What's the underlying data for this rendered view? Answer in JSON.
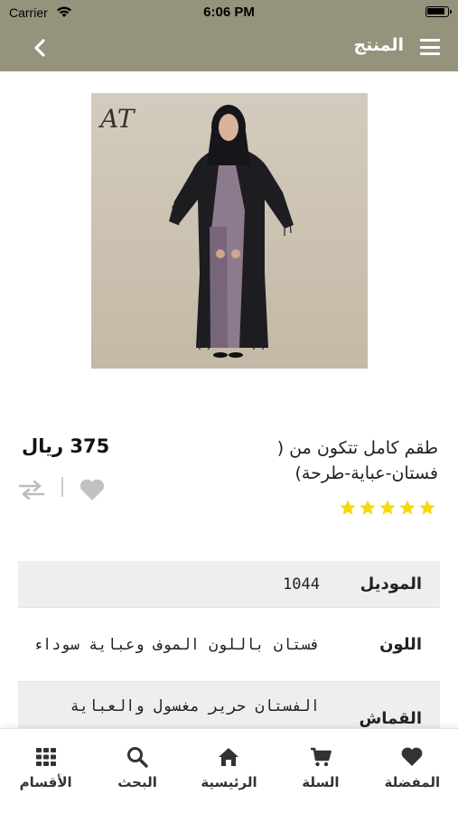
{
  "status_bar": {
    "carrier": "Carrier",
    "time": "6:06 PM"
  },
  "nav": {
    "title": "المنتج"
  },
  "product": {
    "image_brand_monogram": "AT",
    "title": "طقم كامل تتكون من ( فستان-عباية-طرحة)",
    "price": "375 ريال",
    "rating_stars": 5,
    "star_color": "#f5d90c"
  },
  "specs": [
    {
      "label": "الموديل",
      "value": "1044"
    },
    {
      "label": "اللون",
      "value": "فستان باللون الموف وعباية سوداء"
    },
    {
      "label": "القماش",
      "value": "الفستان حرير مغسول والعباية"
    }
  ],
  "tabs": [
    {
      "label": "المفضلة",
      "icon": "heart-icon"
    },
    {
      "label": "السلة",
      "icon": "cart-icon"
    },
    {
      "label": "الرئيسية",
      "icon": "home-icon"
    },
    {
      "label": "البحث",
      "icon": "search-icon"
    },
    {
      "label": "الأقسام",
      "icon": "grid-icon"
    }
  ],
  "colors": {
    "nav_bg": "#96937d",
    "accent_star": "#f5d90c"
  }
}
